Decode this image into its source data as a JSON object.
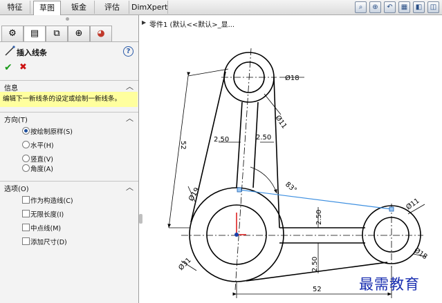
{
  "tabs": [
    "特征",
    "草图",
    "钣金",
    "评估",
    "DimXpert"
  ],
  "active_tab": "草图",
  "view_tools": [
    "zoom-to-fit-icon",
    "zoom-area-icon",
    "previous-view-icon",
    "section-view-icon",
    "view-orientation-icon",
    "display-style-icon"
  ],
  "panel": {
    "tab_icons": [
      "feature-manager-icon",
      "property-manager-icon",
      "configuration-manager-icon",
      "dimxpert-manager-icon",
      "display-manager-icon"
    ],
    "title": "插入线条",
    "help": "?",
    "ok": "✔",
    "cancel": "✖",
    "info": {
      "heading": "信息",
      "text": "编辑下一新线条的设定或绘制一新线条。"
    },
    "orientation": {
      "heading": "方向(T)",
      "options": [
        "按绘制原样(S)",
        "水平(H)",
        "竖直(V)",
        "角度(A)"
      ],
      "selected": "按绘制原样(S)"
    },
    "options": {
      "heading": "选项(O)",
      "items": [
        "作为构造线(C)",
        "无限长度(I)",
        "中点线(M)",
        "添加尺寸(D)"
      ]
    }
  },
  "tree_crumb": "零件1 (默认<<默认>_显...",
  "dimensions": {
    "d_top_circle": "Ø18",
    "d_top_inner": "Ø11",
    "d_right_circle": "Ø11",
    "d_right_outer": "Ø18",
    "d_big_circle": "Ø31",
    "d_big_inner": "Ø19",
    "len_52_left": "52",
    "len_52_bottom": "52",
    "w_250_a": "2.50",
    "w_250_b": "2.50",
    "w_250_c": "2.50",
    "w_250_d": "2.50",
    "angle": "83°"
  },
  "watermark": "最需教育",
  "colors": {
    "new_line": "#3d8fe0",
    "info_bg": "#ffff9e",
    "ok": "#1a9b1a",
    "cancel": "#cc1111"
  }
}
